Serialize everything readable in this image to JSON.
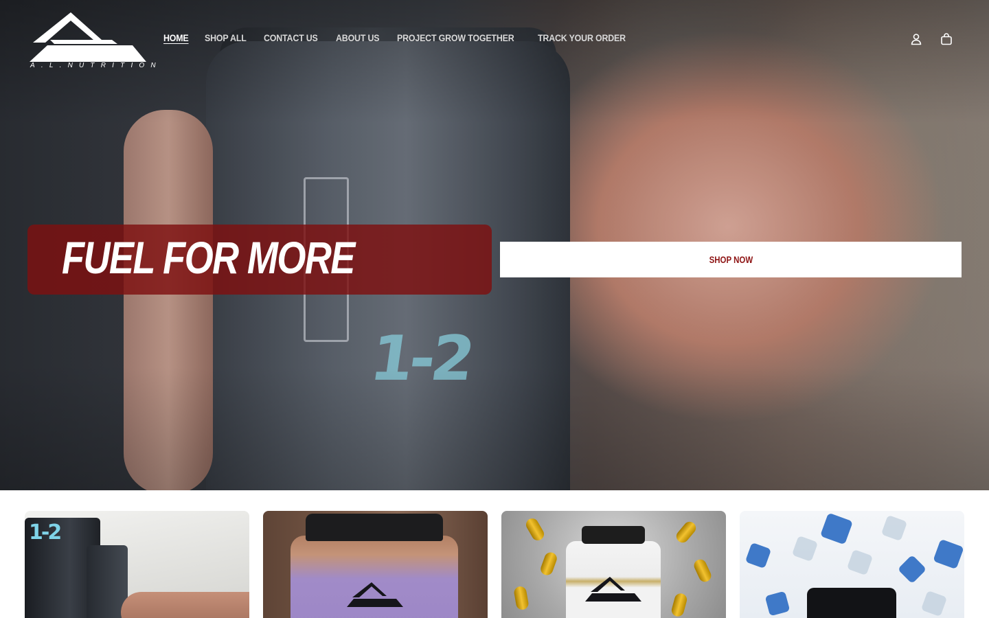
{
  "brand": {
    "name": "A.L.NUTRITION",
    "logo_text": "A.L.NUTRITION"
  },
  "nav": {
    "items": [
      {
        "label": "HOME",
        "active": true
      },
      {
        "label": "SHOP ALL",
        "active": false
      },
      {
        "label": "CONTACT US",
        "active": false
      },
      {
        "label": "ABOUT US",
        "active": false
      },
      {
        "label": "PROJECT GROW TOGETHER",
        "active": false
      },
      {
        "label": "TRACK YOUR ORDER",
        "active": false
      }
    ]
  },
  "header_icons": {
    "account": "account-icon",
    "cart": "cart-icon"
  },
  "hero": {
    "headline": "FUEL FOR MORE",
    "cta_label": "SHOP NOW"
  },
  "colors": {
    "accent_red": "#8e1414",
    "headline_box": "#7e1010",
    "white": "#ffffff"
  },
  "cards": [
    {
      "name": "product-card-1"
    },
    {
      "name": "product-card-2"
    },
    {
      "name": "product-card-3"
    },
    {
      "name": "product-card-4"
    }
  ]
}
